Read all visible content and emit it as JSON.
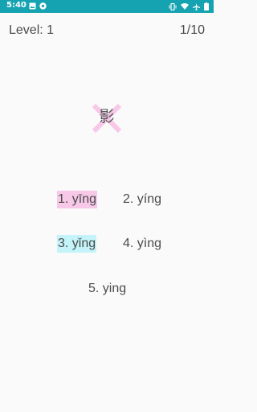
{
  "status_bar": {
    "time": "5:40",
    "left_icons": [
      "image-icon",
      "notification-icon"
    ],
    "right_icons": [
      "vibrate-icon",
      "wifi-icon",
      "airplane-icon",
      "battery-icon"
    ]
  },
  "header": {
    "level_label": "Level: 1",
    "progress": "1/10"
  },
  "question": {
    "character": "影",
    "state": "wrong",
    "cross_color": "#f7c8e8"
  },
  "options": [
    {
      "label": "1. yīng",
      "state": "wrong",
      "highlight": "#f7c8e8"
    },
    {
      "label": "2. yíng",
      "state": "none"
    },
    {
      "label": "3. yǐng",
      "state": "correct",
      "highlight": "#c4f4f9"
    },
    {
      "label": "4. yìng",
      "state": "none"
    },
    {
      "label": "5. ying",
      "state": "none"
    }
  ],
  "colors": {
    "status_bar": "#16a3b1",
    "background": "#fafafa",
    "text": "#4a4a4a"
  }
}
